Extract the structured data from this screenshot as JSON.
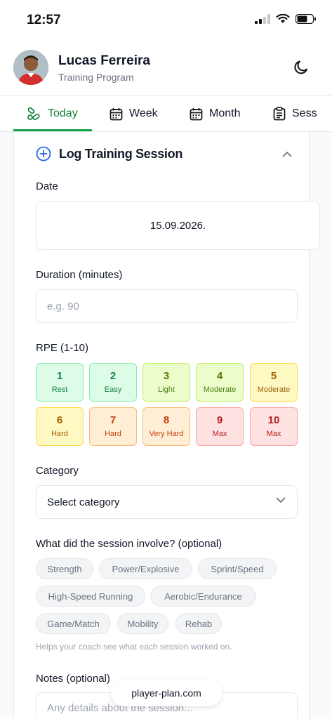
{
  "status_bar": {
    "time": "12:57"
  },
  "header": {
    "name": "Lucas Ferreira",
    "subtitle": "Training Program"
  },
  "tabs": [
    {
      "label": "Today",
      "icon": "pills-icon",
      "active": true
    },
    {
      "label": "Week",
      "icon": "calendar-icon",
      "active": false
    },
    {
      "label": "Month",
      "icon": "calendar-icon",
      "active": false
    },
    {
      "label": "Sess",
      "icon": "clipboard-icon",
      "active": false
    }
  ],
  "form": {
    "title": "Log Training Session",
    "date_label": "Date",
    "date_value": "15.09.2026.",
    "duration_label": "Duration (minutes)",
    "duration_placeholder": "e.g. 90",
    "rpe_label": "RPE (1-10)",
    "rpe": [
      {
        "num": "1",
        "label": "Rest",
        "bg": "#dcfce7",
        "border": "#86efac",
        "color": "#15803d"
      },
      {
        "num": "2",
        "label": "Easy",
        "bg": "#dcfce7",
        "border": "#86efac",
        "color": "#15803d"
      },
      {
        "num": "3",
        "label": "Light",
        "bg": "#ecfccb",
        "border": "#bef264",
        "color": "#4d7c0f"
      },
      {
        "num": "4",
        "label": "Moderate",
        "bg": "#ecfccb",
        "border": "#bef264",
        "color": "#4d7c0f"
      },
      {
        "num": "5",
        "label": "Moderate",
        "bg": "#fef9c3",
        "border": "#fde047",
        "color": "#a16207"
      },
      {
        "num": "6",
        "label": "Hard",
        "bg": "#fef9c3",
        "border": "#fde047",
        "color": "#a16207"
      },
      {
        "num": "7",
        "label": "Hard",
        "bg": "#ffedd5",
        "border": "#fdba74",
        "color": "#c2410c"
      },
      {
        "num": "8",
        "label": "Very Hard",
        "bg": "#ffedd5",
        "border": "#fdba74",
        "color": "#c2410c"
      },
      {
        "num": "9",
        "label": "Max",
        "bg": "#fee2e2",
        "border": "#fca5a5",
        "color": "#b91c1c"
      },
      {
        "num": "10",
        "label": "Max",
        "bg": "#fee2e2",
        "border": "#fca5a5",
        "color": "#b91c1c"
      }
    ],
    "category_label": "Category",
    "category_value": "Select category",
    "involve_label": "What did the session involve? (optional)",
    "chips": [
      "Strength",
      "Power/Explosive",
      "Sprint/Speed",
      "High-Speed Running",
      "Aerobic/Endurance",
      "Game/Match",
      "Mobility",
      "Rehab"
    ],
    "helper": "Helps your coach see what each session worked on.",
    "notes_label": "Notes (optional)",
    "notes_placeholder": "Any details about the session..."
  },
  "url": "player-plan.com",
  "colors": {
    "accent": "#16a34a",
    "title_icon": "#2563eb"
  }
}
